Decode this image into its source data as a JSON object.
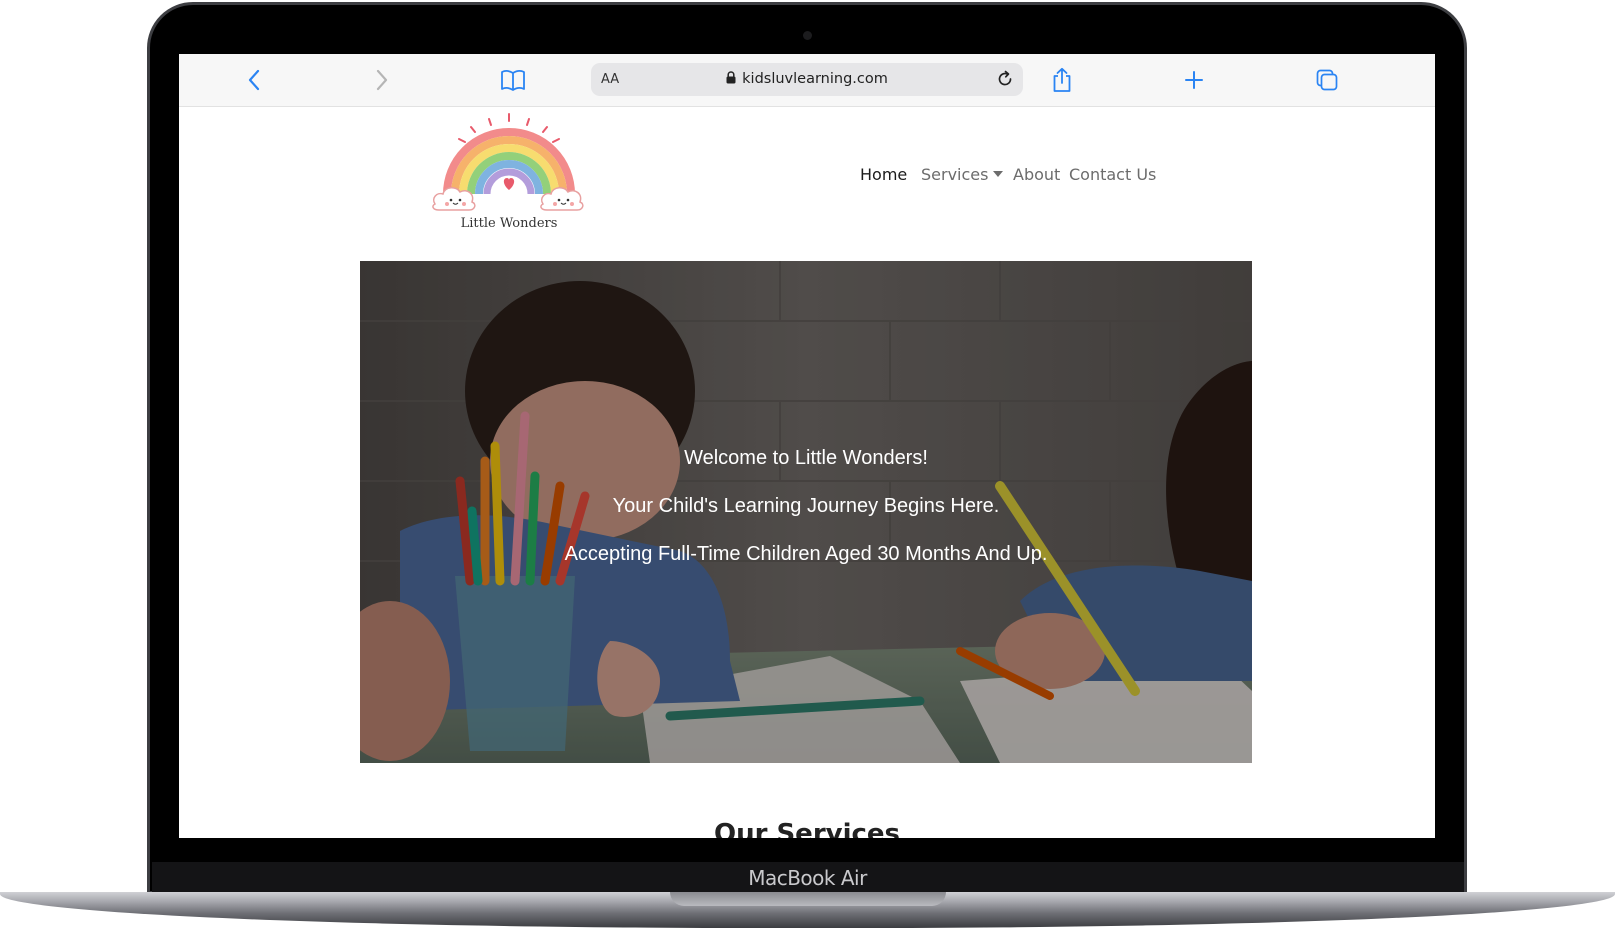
{
  "browser": {
    "url": "kidsluvlearning.com",
    "reader_label": "AA",
    "icons": {
      "back": "chevron-left-icon",
      "forward": "chevron-right-icon",
      "bookmarks": "book-icon",
      "lock": "lock-icon",
      "reload": "reload-icon",
      "share": "share-icon",
      "new_tab": "plus-icon",
      "tabs": "tabs-icon"
    },
    "accent_color": "#2a84f3"
  },
  "site": {
    "logo_text": "Little Wonders",
    "nav": {
      "home": "Home",
      "services": "Services",
      "about": "About",
      "contact": "Contact Us"
    },
    "hero": {
      "line1": "Welcome to Little Wonders!",
      "line2": "Your Child's Learning Journey Begins Here.",
      "line3": "Accepting Full-Time Children Aged 30 Months And Up."
    },
    "section_title": "Our Services"
  },
  "device": {
    "label": "MacBook Air"
  }
}
